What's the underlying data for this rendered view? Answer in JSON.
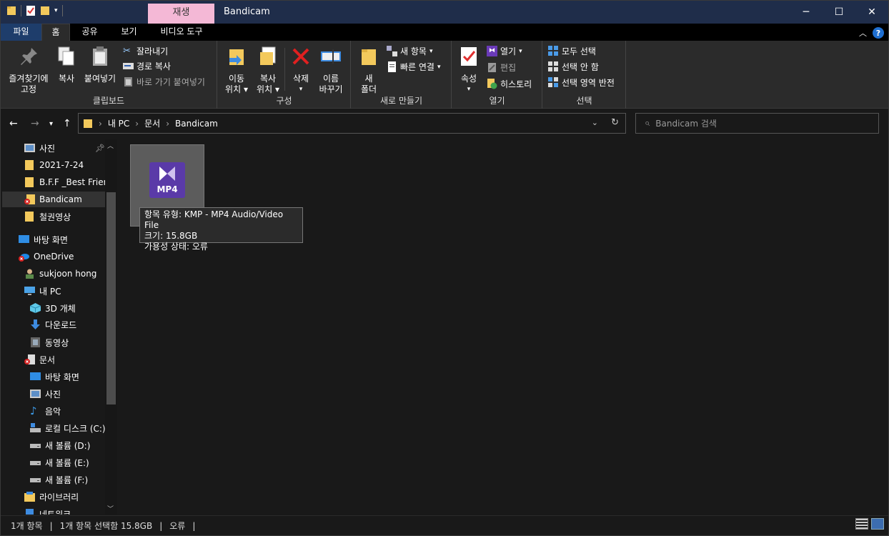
{
  "window": {
    "title": "Bandicam",
    "context_tab": "재생",
    "minimize": "─",
    "maximize": "☐",
    "close": "✕"
  },
  "tabs": [
    {
      "label": "파일"
    },
    {
      "label": "홈"
    },
    {
      "label": "공유"
    },
    {
      "label": "보기"
    },
    {
      "label": "비디오 도구"
    }
  ],
  "ribbon": {
    "clipboard": {
      "label": "클립보드",
      "pin_l1": "즐겨찾기에",
      "pin_l2": "고정",
      "copy": "복사",
      "paste": "붙여넣기",
      "cut": "잘라내기",
      "copy_path": "경로 복사",
      "paste_shortcut": "바로 가기 붙여넣기"
    },
    "organize": {
      "label": "구성",
      "move_l1": "이동",
      "move_l2": "위치",
      "copyto_l1": "복사",
      "copyto_l2": "위치",
      "delete": "삭제",
      "rename_l1": "이름",
      "rename_l2": "바꾸기"
    },
    "new": {
      "label": "새로 만들기",
      "folder_l1": "새",
      "folder_l2": "폴더",
      "new_item": "새 항목",
      "easy_access": "빠른 연결"
    },
    "open": {
      "label": "열기",
      "properties": "속성",
      "open": "열기",
      "edit": "편집",
      "history": "히스토리"
    },
    "select": {
      "label": "선택",
      "all": "모두 선택",
      "none": "선택 안 함",
      "invert": "선택 영역 반전"
    }
  },
  "address": {
    "crumbs": [
      "내 PC",
      "문서",
      "Bandicam"
    ],
    "search_placeholder": "Bandicam 검색"
  },
  "nav": [
    {
      "label": "사진"
    },
    {
      "label": "2021-7-24"
    },
    {
      "label": "B.F.F _Best Friend"
    },
    {
      "label": "Bandicam"
    },
    {
      "label": "철권영상"
    },
    {
      "label": "바탕 화면"
    },
    {
      "label": "OneDrive"
    },
    {
      "label": "sukjoon hong"
    },
    {
      "label": "내 PC"
    },
    {
      "label": "3D 개체"
    },
    {
      "label": "다운로드"
    },
    {
      "label": "동영상"
    },
    {
      "label": "문서"
    },
    {
      "label": "바탕 화면"
    },
    {
      "label": "사진"
    },
    {
      "label": "음악"
    },
    {
      "label": "로컬 디스크 (C:)"
    },
    {
      "label": "새 볼륨 (D:)"
    },
    {
      "label": "새 볼륨 (E:)"
    },
    {
      "label": "새 볼륨 (F:)"
    },
    {
      "label": "라이브러리"
    },
    {
      "label": "네트워크"
    }
  ],
  "file": {
    "icon_text": "MP4",
    "tooltip_type": "항목 유형: KMP - MP4 Audio/Video File",
    "tooltip_size": "크기: 15.8GB",
    "tooltip_status": "가용성 상태: 오류"
  },
  "status": {
    "count": "1개 항목",
    "selected": "1개 항목 선택함 15.8GB",
    "state": "오류",
    "sep": "|"
  }
}
